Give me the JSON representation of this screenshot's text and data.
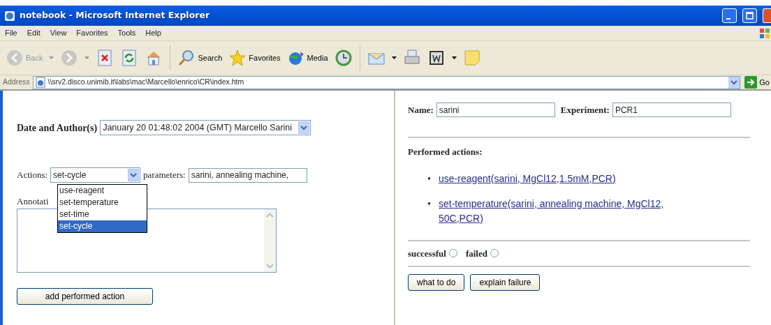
{
  "window": {
    "title": "notebook - Microsoft Internet Explorer"
  },
  "menu": [
    "File",
    "Edit",
    "View",
    "Favorites",
    "Tools",
    "Help"
  ],
  "toolbar": [
    {
      "kind": "back",
      "label": "Back",
      "disabled": true,
      "dropdown": true
    },
    {
      "kind": "forward",
      "disabled": true,
      "dropdown": true
    },
    {
      "kind": "stop",
      "disabled": false
    },
    {
      "kind": "refresh",
      "disabled": false
    },
    {
      "kind": "home",
      "disabled": false
    },
    {
      "kind": "search",
      "label": "Search",
      "disabled": false
    },
    {
      "kind": "favorites",
      "label": "Favorites",
      "disabled": false
    },
    {
      "kind": "media",
      "label": "Media",
      "disabled": false
    },
    {
      "kind": "history",
      "disabled": false
    },
    {
      "kind": "mail",
      "disabled": false,
      "dropdown": true
    },
    {
      "kind": "print",
      "disabled": false
    },
    {
      "kind": "word",
      "disabled": false,
      "dropdown": true
    },
    {
      "kind": "note",
      "disabled": false
    }
  ],
  "address": {
    "label": "Address",
    "url": "\\\\srv2.disco.unimib.it\\labs\\mac\\Marcello\\enrico\\CR\\index.htm",
    "go": "Go"
  },
  "left": {
    "date_label": "Date and Author(s)",
    "date_value": "January 20 01:48:02 2004 (GMT) Marcello Sarini",
    "actions_label": "Actions:",
    "actions_value": "set-cycle",
    "action_options": [
      {
        "label": "use-reagent",
        "selected": false
      },
      {
        "label": "set-temperature",
        "selected": false
      },
      {
        "label": "set-time",
        "selected": false
      },
      {
        "label": "set-cycle",
        "selected": true
      }
    ],
    "parameters_label": "parameters:",
    "parameters_value": "sarini, annealing machine,",
    "annotation_label": "Annotati",
    "add_button": "add performed action"
  },
  "right": {
    "name_label": "Name:",
    "name_value": "sarini",
    "experiment_label": "Experiment:",
    "experiment_value": "PCR1",
    "performed_title": "Performed actions:",
    "performed": [
      {
        "bullet": "•",
        "text": "use-reagent(sarini, MgCl12,1.5mM,PCR)"
      },
      {
        "bullet": "•",
        "text": "set-temperature(sarini, annealing machine, MgCl12, 50C,PCR)"
      }
    ],
    "outcomes": [
      {
        "label": "successful",
        "selected": false
      },
      {
        "label": "failed",
        "selected": false
      }
    ],
    "buttons": [
      "what to do",
      "explain failure"
    ]
  }
}
